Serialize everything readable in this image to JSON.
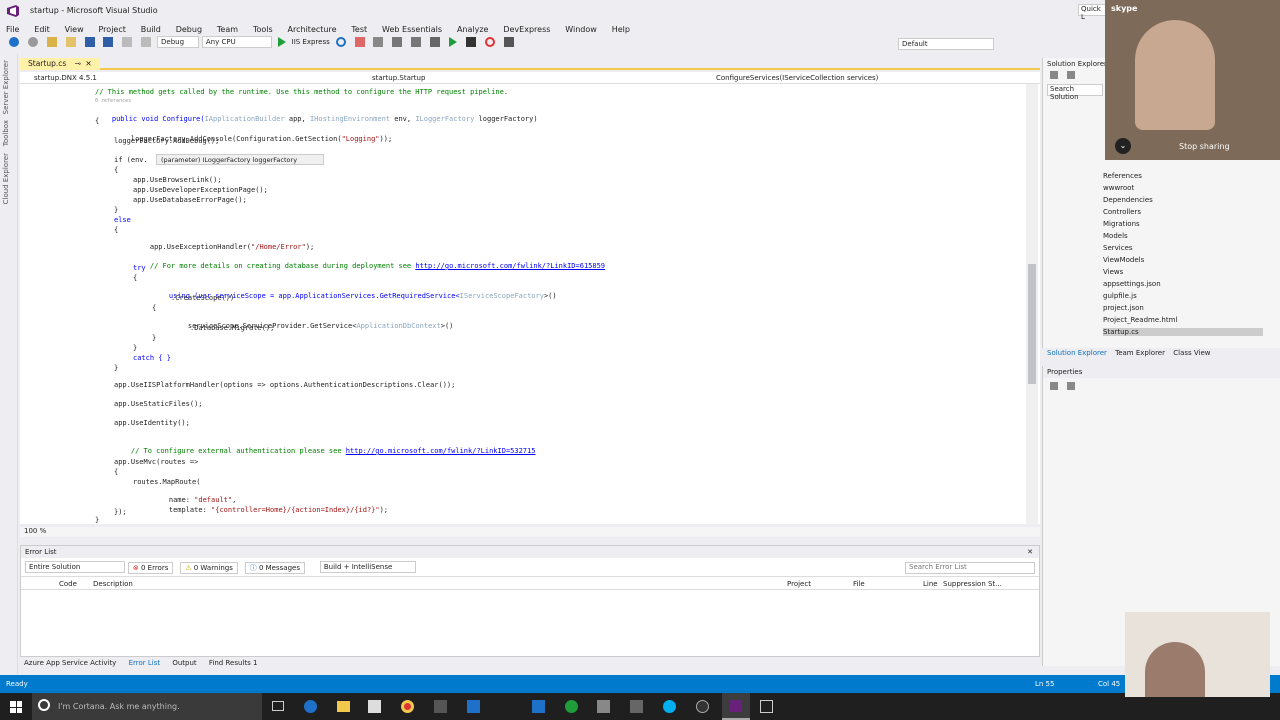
{
  "title": "startup - Microsoft Visual Studio",
  "quick_launch": "Quick L",
  "menu": [
    "File",
    "Edit",
    "View",
    "Project",
    "Build",
    "Debug",
    "Team",
    "Tools",
    "Architecture",
    "Test",
    "Web Essentials",
    "Analyze",
    "DevExpress",
    "Window",
    "Help"
  ],
  "toolbar": {
    "config": "Debug",
    "platform": "Any CPU",
    "run": "IIS Express",
    "layout": "Default"
  },
  "left_strip": [
    "Server Explorer",
    "Toolbox",
    "Cloud Explorer"
  ],
  "doc_tab": "Startup.cs",
  "nav": {
    "project": "startup.DNX 4.5.1",
    "class": "startup.Startup",
    "member": "ConfigureServices(IServiceCollection services)"
  },
  "code": {
    "l1": "// This method gets called by the runtime. Use this method to configure the HTTP request pipeline.",
    "l2": "0 references",
    "l3a": "public void Configure(",
    "l3b": "IApplicationBuilder",
    "l3c": " app, ",
    "l3d": "IHostingEnvironment",
    "l3e": " env, ",
    "l3f": "ILoggerFactory",
    "l3g": " loggerFactory)",
    "l4": "{",
    "l5a": "loggerFactory.AddConsole(Configuration.GetSection(",
    "l5b": "\"Logging\"",
    "l5c": "));",
    "l6": "loggerFactory.AddDebug();",
    "l7": "if (env.",
    "tooltip": "(parameter) ILoggerFactory loggerFactory",
    "l8": "{",
    "l9": "app.UseBrowserLink();",
    "l10": "app.UseDeveloperExceptionPage();",
    "l11": "app.UseDatabaseErrorPage();",
    "l12": "}",
    "l13": "else",
    "l14": "{",
    "l15a": "app.UseExceptionHandler(",
    "l15b": "\"/Home/Error\"",
    "l15c": ");",
    "l16a": "// For more details on creating database during deployment see ",
    "l16b": "http://go.microsoft.com/fwlink/?LinkID=615859",
    "l17": "try",
    "l18": "{",
    "l19a": "using (var serviceScope = app.ApplicationServices.GetRequiredService<",
    "l19b": "IServiceScopeFactory",
    "l19c": ">()",
    "l20": ".CreateScope())",
    "l21": "{",
    "l22a": "serviceScope.ServiceProvider.GetService<",
    "l22b": "ApplicationDbContext",
    "l22c": ">()",
    "l23": ".Database.Migrate();",
    "l24": "}",
    "l25": "}",
    "l26": "catch { }",
    "l27": "}",
    "l28": "app.UseIISPlatformHandler(options => options.AuthenticationDescriptions.Clear());",
    "l29": "app.UseStaticFiles();",
    "l30": "app.UseIdentity();",
    "l31a": "// To configure external authentication please see ",
    "l31b": "http://go.microsoft.com/fwlink/?LinkID=532715",
    "l32": "app.UseMvc(routes =>",
    "l33": "{",
    "l34": "routes.MapRoute(",
    "l35a": "name: ",
    "l35b": "\"default\"",
    "l35c": ",",
    "l36a": "template: ",
    "l36b": "\"{controller=Home}/{action=Index}/{id?}\"",
    "l36c": ");",
    "l37": "});",
    "l38": "}"
  },
  "zoom": "100 %",
  "error_list": {
    "title": "Error List",
    "scope": "Entire Solution",
    "errors": "0 Errors",
    "warnings": "0 Warnings",
    "messages": "0 Messages",
    "filter": "Build + IntelliSense",
    "search_placeholder": "Search Error List",
    "cols": [
      "Code",
      "Description",
      "Project",
      "File",
      "Line",
      "Suppression St..."
    ]
  },
  "bottom_tabs": [
    "Azure App Service Activity",
    "Error List",
    "Output",
    "Find Results 1"
  ],
  "status": {
    "left": "Ready",
    "ln": "Ln 55",
    "col": "Col 45"
  },
  "taskbar": {
    "cortana": "I'm Cortana. Ask me anything."
  },
  "solution": {
    "title": "Solution Explorer",
    "search": "Search Solution",
    "items": [
      "References",
      "wwwroot",
      "Dependencies",
      "Controllers",
      "Migrations",
      "Models",
      "Services",
      "ViewModels",
      "Views",
      "appsettings.json",
      "gulpfile.js",
      "project.json",
      "Project_Readme.html",
      "Startup.cs"
    ],
    "tabs": [
      "Solution Explorer",
      "Team Explorer",
      "Class View"
    ]
  },
  "properties": {
    "title": "Properties"
  },
  "webcam": {
    "stop_sharing": "Stop sharing",
    "skype": "skype"
  }
}
